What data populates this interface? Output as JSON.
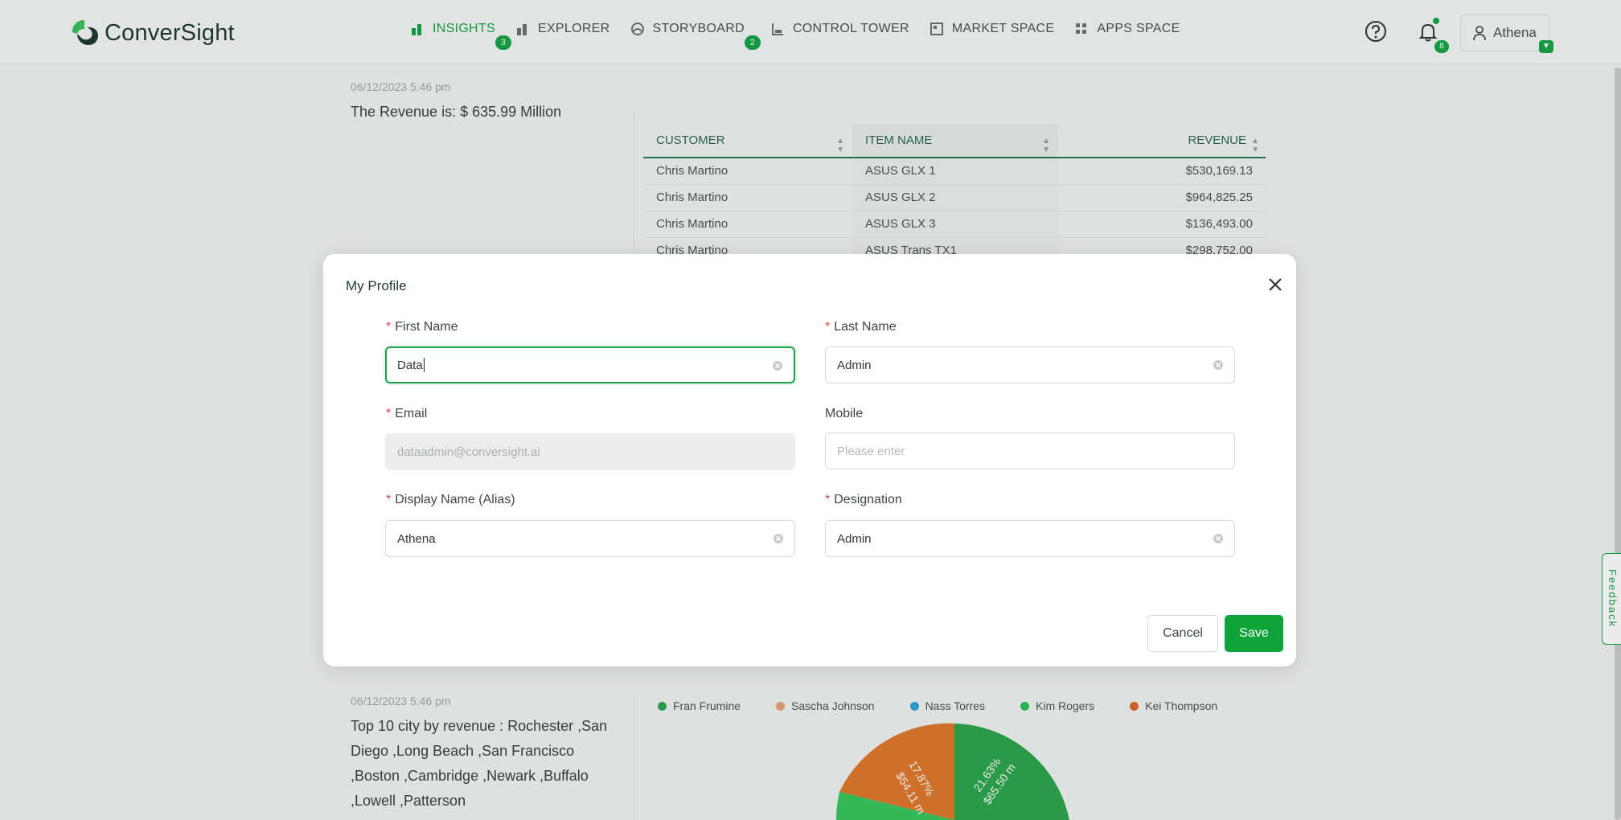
{
  "header": {
    "brand": "ConverSight",
    "nav": [
      {
        "label": "INSIGHTS",
        "badge": "3",
        "active": true
      },
      {
        "label": "EXPLORER",
        "badge": ""
      },
      {
        "label": "STORYBOARD",
        "badge": "2"
      },
      {
        "label": "CONTROL TOWER",
        "badge": ""
      },
      {
        "label": "MARKET SPACE",
        "badge": ""
      },
      {
        "label": "APPS SPACE",
        "badge": ""
      }
    ],
    "notifications_count": "8",
    "user_name": "Athena"
  },
  "background": {
    "card1": {
      "timestamp": "06/12/2023 5:46 pm",
      "summary": "The Revenue is: $ 635.99 Million",
      "table": {
        "headers": [
          "CUSTOMER",
          "ITEM NAME",
          "REVENUE"
        ],
        "rows": [
          [
            "Chris Martino",
            "ASUS GLX 1",
            "$530,169.13"
          ],
          [
            "Chris Martino",
            "ASUS GLX 2",
            "$964,825.25"
          ],
          [
            "Chris Martino",
            "ASUS GLX 3",
            "$136,493.00"
          ],
          [
            "Chris Martino",
            "ASUS Trans TX1",
            "$298,752.00"
          ]
        ]
      }
    },
    "card2": {
      "timestamp": "06/12/2023 5:46 pm",
      "summary": "Top 10 city by revenue : Rochester ,San Diego ,Long Beach ,San Francisco ,Boston ,Cambridge ,Newark ,Buffalo ,Lowell ,Patterson",
      "legend": [
        {
          "name": "Fran Frumine",
          "color": "#2fa84f"
        },
        {
          "name": "Sascha Johnson",
          "color": "#e8a47c"
        },
        {
          "name": "Nass Torres",
          "color": "#2aa7d8"
        },
        {
          "name": "Kim Rogers",
          "color": "#2fbf55"
        },
        {
          "name": "Kei Thompson",
          "color": "#e0692e"
        }
      ],
      "pie_labels": [
        {
          "pct": "17.87%",
          "value": "$54.11 m"
        },
        {
          "pct": "21.63%",
          "value": "$65.50 m"
        }
      ]
    },
    "feedback": "Feedback"
  },
  "modal": {
    "title": "My Profile",
    "fields": {
      "first_name": {
        "label": "First Name",
        "value": "Data",
        "required": true
      },
      "last_name": {
        "label": "Last Name",
        "value": "Admin",
        "required": true
      },
      "email": {
        "label": "Email",
        "value": "dataadmin@conversight.ai",
        "required": true
      },
      "mobile": {
        "label": "Mobile",
        "placeholder": "Please enter"
      },
      "display_name": {
        "label": "Display Name (Alias)",
        "value": "Athena",
        "required": true
      },
      "designation": {
        "label": "Designation",
        "value": "Admin",
        "required": true
      }
    },
    "cancel_label": "Cancel",
    "save_label": "Save"
  }
}
